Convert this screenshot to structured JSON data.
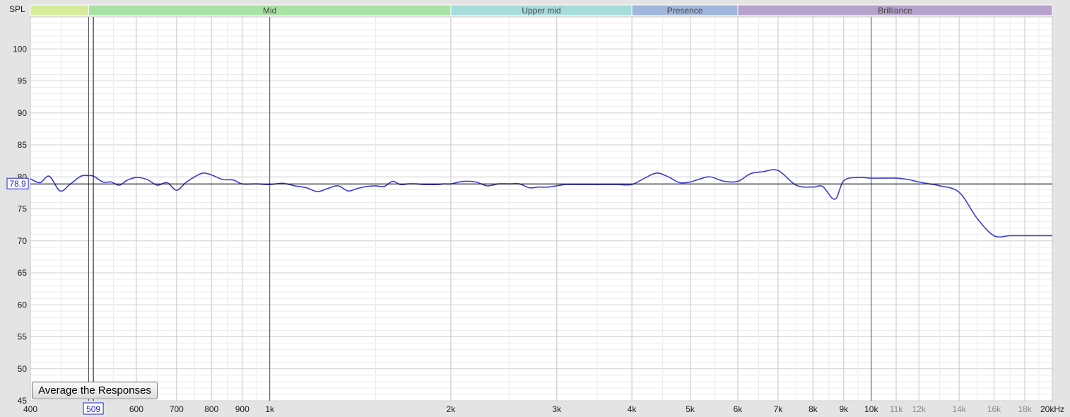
{
  "chart_data": {
    "type": "line",
    "ylabel": "SPL",
    "xunit": "kHz",
    "xscale": "log",
    "xlim": [
      400,
      20000
    ],
    "ylim": [
      45,
      105
    ],
    "grid": true,
    "yticks": [
      45,
      50,
      55,
      60,
      65,
      70,
      75,
      80,
      85,
      90,
      95,
      100
    ],
    "xticks": [
      {
        "value": 400,
        "label": "400",
        "style": "major"
      },
      {
        "value": 600,
        "label": "600",
        "style": "major"
      },
      {
        "value": 700,
        "label": "700",
        "style": "major"
      },
      {
        "value": 800,
        "label": "800",
        "style": "major"
      },
      {
        "value": 900,
        "label": "900",
        "style": "major"
      },
      {
        "value": 1000,
        "label": "1k",
        "style": "major"
      },
      {
        "value": 2000,
        "label": "2k",
        "style": "major"
      },
      {
        "value": 3000,
        "label": "3k",
        "style": "major"
      },
      {
        "value": 4000,
        "label": "4k",
        "style": "major"
      },
      {
        "value": 5000,
        "label": "5k",
        "style": "major"
      },
      {
        "value": 6000,
        "label": "6k",
        "style": "major"
      },
      {
        "value": 7000,
        "label": "7k",
        "style": "major"
      },
      {
        "value": 8000,
        "label": "8k",
        "style": "major"
      },
      {
        "value": 9000,
        "label": "9k",
        "style": "major"
      },
      {
        "value": 10000,
        "label": "10k",
        "style": "major"
      },
      {
        "value": 11000,
        "label": "11k",
        "style": "minor"
      },
      {
        "value": 12000,
        "label": "12k",
        "style": "minor"
      },
      {
        "value": 14000,
        "label": "14k",
        "style": "minor"
      },
      {
        "value": 16000,
        "label": "16k",
        "style": "minor"
      },
      {
        "value": 18000,
        "label": "18k",
        "style": "minor"
      },
      {
        "value": 20000,
        "label": "20kHz",
        "style": "major"
      }
    ],
    "bands": [
      {
        "label": "",
        "from": 400,
        "to": 500,
        "color": "#d6ec9a"
      },
      {
        "label": "Mid",
        "from": 500,
        "to": 2000,
        "color": "#a8e2a4"
      },
      {
        "label": "Upper mid",
        "from": 2000,
        "to": 4000,
        "color": "#a6dcdc"
      },
      {
        "label": "Presence",
        "from": 4000,
        "to": 6000,
        "color": "#a0b6dc"
      },
      {
        "label": "Brilliance",
        "from": 6000,
        "to": 20000,
        "color": "#b6a2cc"
      }
    ],
    "cursor": {
      "x": 509,
      "x_label": "509",
      "y": 78.9,
      "y_label": "78.9"
    },
    "series": [
      {
        "color": "#3c3cd2",
        "x": [
          400,
          415,
          430,
          448,
          465,
          485,
          500,
          510,
          528,
          545,
          562,
          580,
          600,
          625,
          650,
          675,
          700,
          725,
          750,
          775,
          800,
          835,
          870,
          900,
          950,
          1000,
          1050,
          1100,
          1150,
          1200,
          1250,
          1300,
          1350,
          1400,
          1450,
          1500,
          1550,
          1600,
          1650,
          1700,
          1750,
          1800,
          1850,
          1900,
          1950,
          2000,
          2100,
          2200,
          2300,
          2400,
          2500,
          2600,
          2700,
          2800,
          2900,
          3000,
          3100,
          3200,
          3300,
          3400,
          3500,
          3600,
          3700,
          3800,
          4000,
          4200,
          4400,
          4600,
          4800,
          5000,
          5200,
          5400,
          5700,
          6000,
          6300,
          6600,
          7000,
          7500,
          8000,
          8300,
          8700,
          9000,
          9500,
          10000,
          10500,
          11000,
          11500,
          12000,
          12500,
          13000,
          14000,
          15000,
          16000,
          17000,
          18000,
          19000,
          20000
        ],
        "y": [
          79.7,
          79.1,
          80.1,
          77.8,
          78.8,
          80.1,
          80.2,
          80.1,
          79.2,
          79.2,
          78.7,
          79.5,
          79.9,
          79.6,
          78.7,
          79.1,
          77.9,
          79.1,
          80.0,
          80.6,
          80.3,
          79.6,
          79.5,
          78.9,
          78.9,
          78.8,
          79.0,
          78.6,
          78.3,
          77.7,
          78.2,
          78.6,
          77.8,
          78.2,
          78.5,
          78.6,
          78.5,
          79.3,
          78.8,
          78.9,
          78.9,
          78.8,
          78.8,
          78.8,
          78.9,
          78.9,
          79.3,
          79.2,
          78.6,
          78.9,
          78.9,
          78.9,
          78.3,
          78.4,
          78.4,
          78.6,
          78.8,
          78.8,
          78.8,
          78.8,
          78.8,
          78.8,
          78.8,
          78.8,
          78.8,
          79.8,
          80.6,
          80.0,
          79.1,
          79.2,
          79.7,
          80.0,
          79.3,
          79.3,
          80.5,
          80.8,
          81.0,
          78.7,
          78.4,
          78.5,
          76.5,
          79.4,
          79.9,
          79.8,
          79.8,
          79.8,
          79.6,
          79.2,
          78.9,
          78.6,
          77.6,
          73.5,
          70.8,
          70.8,
          70.8,
          70.8,
          70.8
        ]
      }
    ]
  },
  "ui": {
    "average_button_label": "Average the Responses"
  }
}
